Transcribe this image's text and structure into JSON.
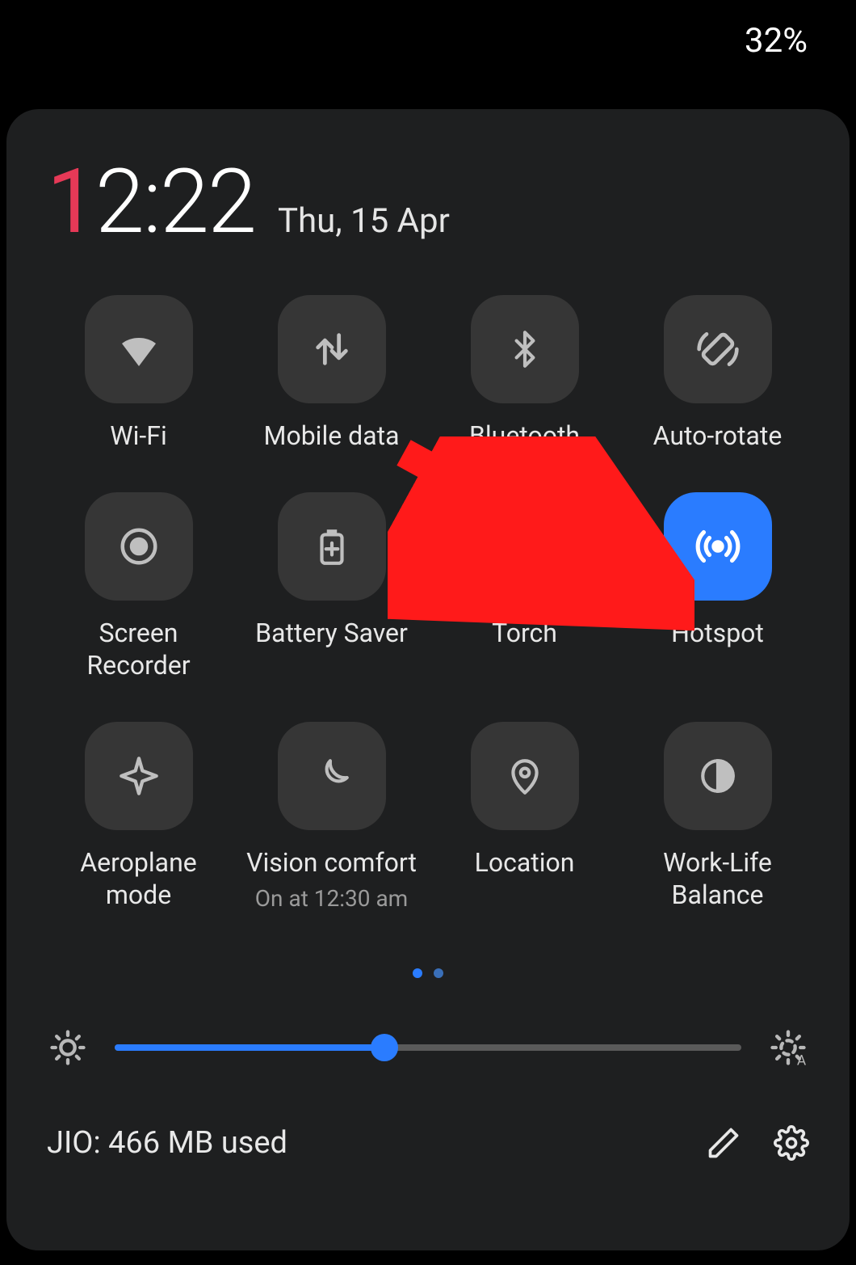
{
  "status": {
    "battery": "32%"
  },
  "clock": {
    "first_digit": "1",
    "rest": "2:22"
  },
  "date": "Thu, 15 Apr",
  "tiles": {
    "wifi": "Wi-Fi",
    "mobile_data": "Mobile data",
    "bluetooth": "Bluetooth",
    "auto_rotate": "Auto-rotate",
    "screen_recorder": "Screen Recorder",
    "battery_saver": "Battery Saver",
    "torch": "Torch",
    "hotspot": "Hotspot",
    "aeroplane": "Aeroplane mode",
    "vision_comfort": "Vision comfort",
    "vision_comfort_sub": "On at 12:30 am",
    "location": "Location",
    "work_life": "Work-Life Balance"
  },
  "brightness": {
    "percent": 43
  },
  "footer": {
    "data_usage": "JIO: 466 MB used"
  },
  "colors": {
    "accent": "#2a7cff",
    "accent_red": "#e63957"
  }
}
